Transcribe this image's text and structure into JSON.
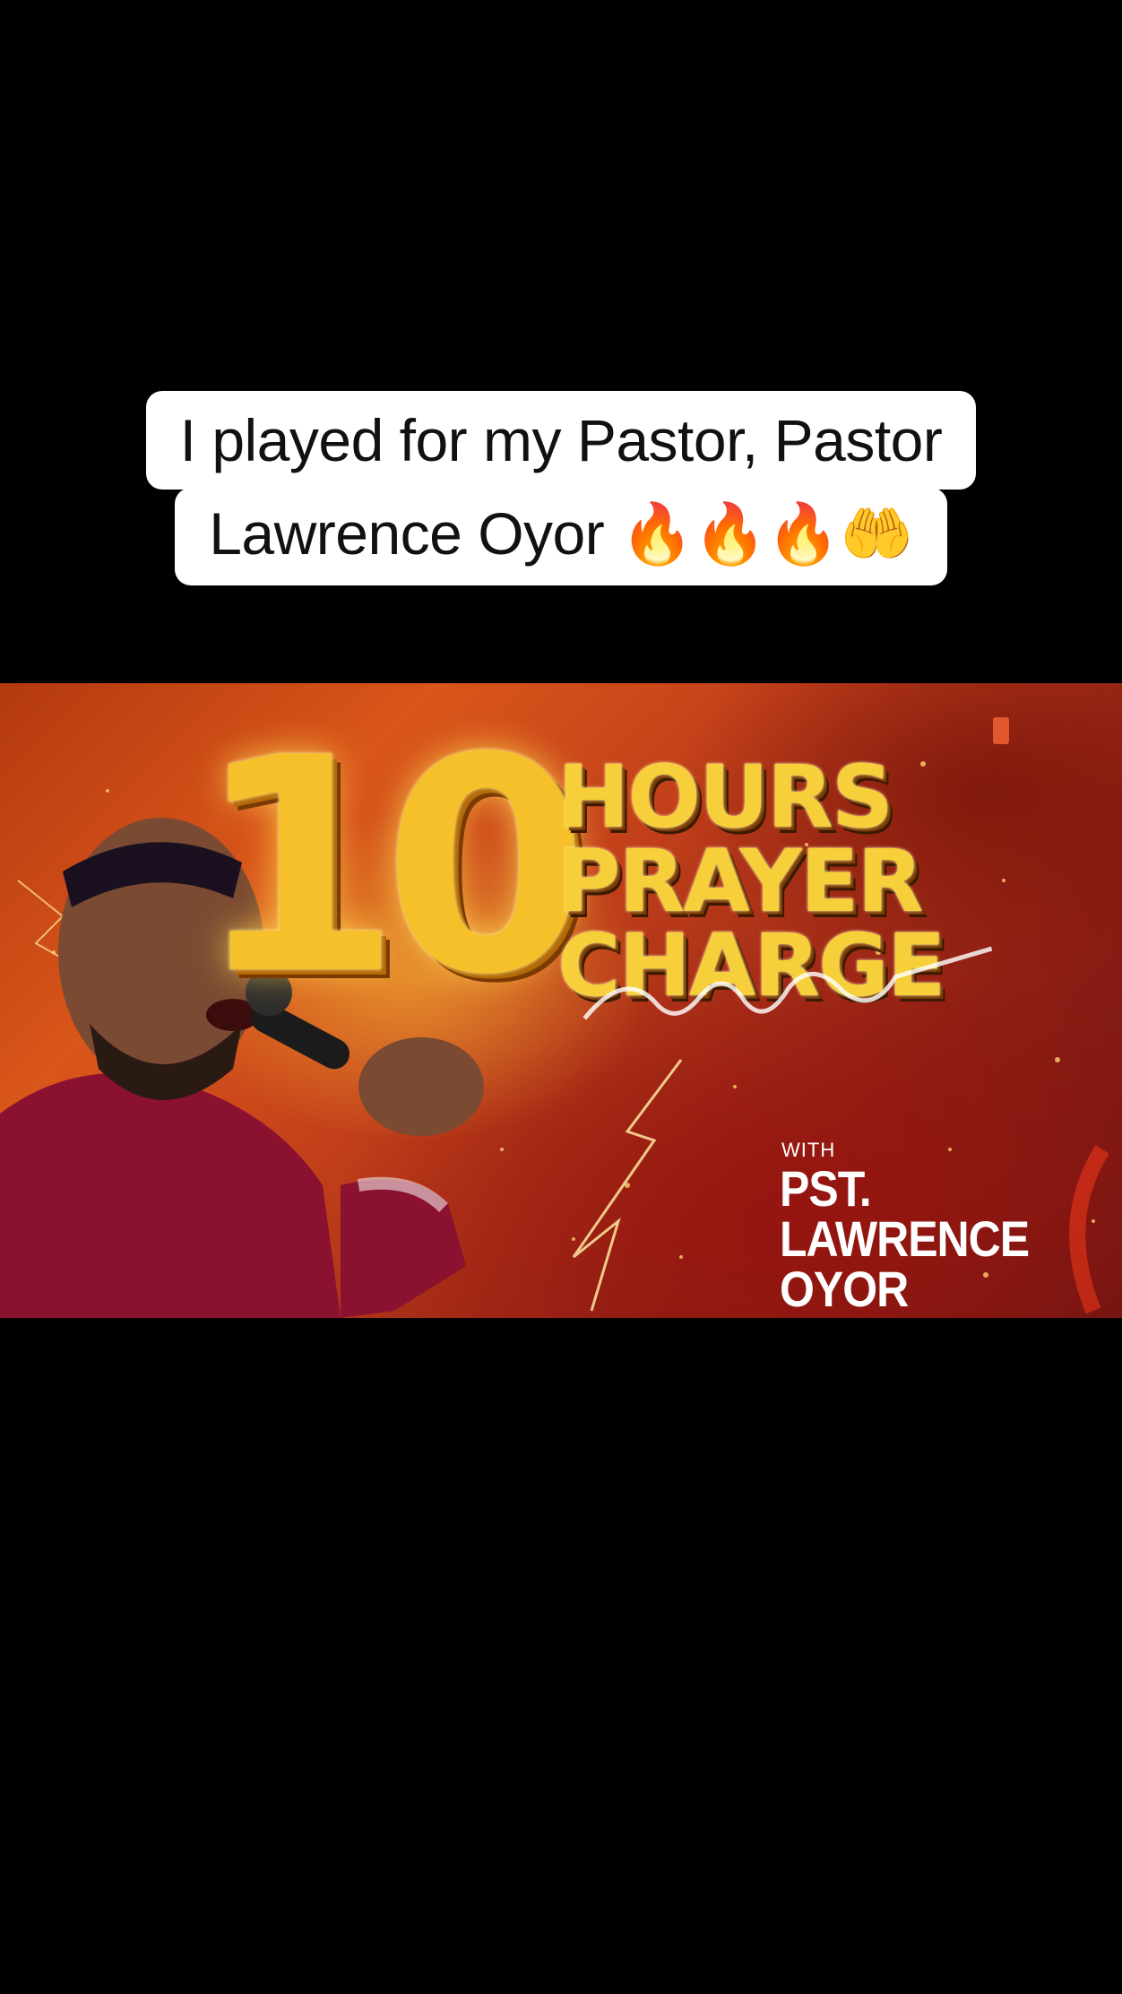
{
  "caption": {
    "line1": "I played for my Pastor, Pastor",
    "line2_text": "Lawrence Oyor ",
    "line2_emoji": "🔥🔥🔥🤲"
  },
  "banner": {
    "number": "10",
    "title_lines": [
      "HOURS",
      "PRAYER",
      "CHARGE"
    ],
    "with_label": "WITH",
    "name_lines": [
      "PST.",
      "LAWRENCE",
      "OYOR"
    ],
    "icons": {
      "person": "preacher-with-microphone-image",
      "logo": "church-logo-icon"
    },
    "colors": {
      "gold": "#f5c02a",
      "fire_orange": "#d9561a",
      "deep_red": "#8e1e14"
    }
  }
}
